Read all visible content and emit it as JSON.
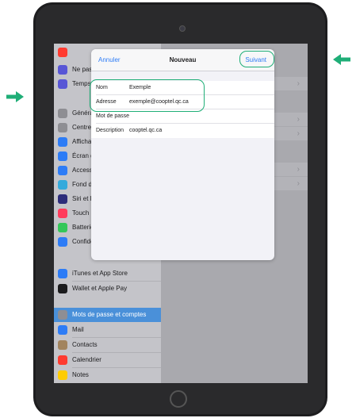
{
  "modal": {
    "cancel": "Annuler",
    "title": "Nouveau",
    "next": "Suivant",
    "fields": [
      {
        "label": "Nom",
        "value": "Exemple"
      },
      {
        "label": "Adresse",
        "value": "exemple@cooptel.qc.ca"
      },
      {
        "label": "Mot de passe",
        "value": ""
      },
      {
        "label": "Description",
        "value": "cooptel.qc.ca"
      }
    ]
  },
  "sidebar": {
    "items_top": [
      {
        "label": "Ne pas",
        "color": "#5856d6"
      },
      {
        "label": "Temps",
        "color": "#5856d6"
      }
    ],
    "items_mid": [
      {
        "label": "Généra",
        "color": "#8e8e93"
      },
      {
        "label": "Centre",
        "color": "#8e8e93"
      },
      {
        "label": "Affichag",
        "color": "#2d7cf6"
      },
      {
        "label": "Écran d",
        "color": "#2d7cf6"
      },
      {
        "label": "Access",
        "color": "#2d7cf6"
      },
      {
        "label": "Fond d",
        "color": "#34aadc"
      },
      {
        "label": "Siri et F",
        "color": "#2c2c7a"
      },
      {
        "label": "Touch I",
        "color": "#ff3b5b"
      },
      {
        "label": "Batterie",
        "color": "#34c759"
      },
      {
        "label": "Confide",
        "color": "#2d7cf6"
      }
    ],
    "items_bottom": [
      {
        "label": "iTunes et App Store",
        "color": "#2d7cf6"
      },
      {
        "label": "Wallet et Apple Pay",
        "color": "#1c1c1e"
      }
    ],
    "items_accounts": [
      {
        "label": "Mots de passe et comptes",
        "color": "#8e8e93"
      },
      {
        "label": "Mail",
        "color": "#2d7cf6"
      },
      {
        "label": "Contacts",
        "color": "#a2845e"
      },
      {
        "label": "Calendrier",
        "color": "#ff3b30"
      },
      {
        "label": "Notes",
        "color": "#ffcc00"
      }
    ]
  },
  "colors": {
    "highlight": "#1fae77",
    "accent": "#2d7cf6"
  }
}
